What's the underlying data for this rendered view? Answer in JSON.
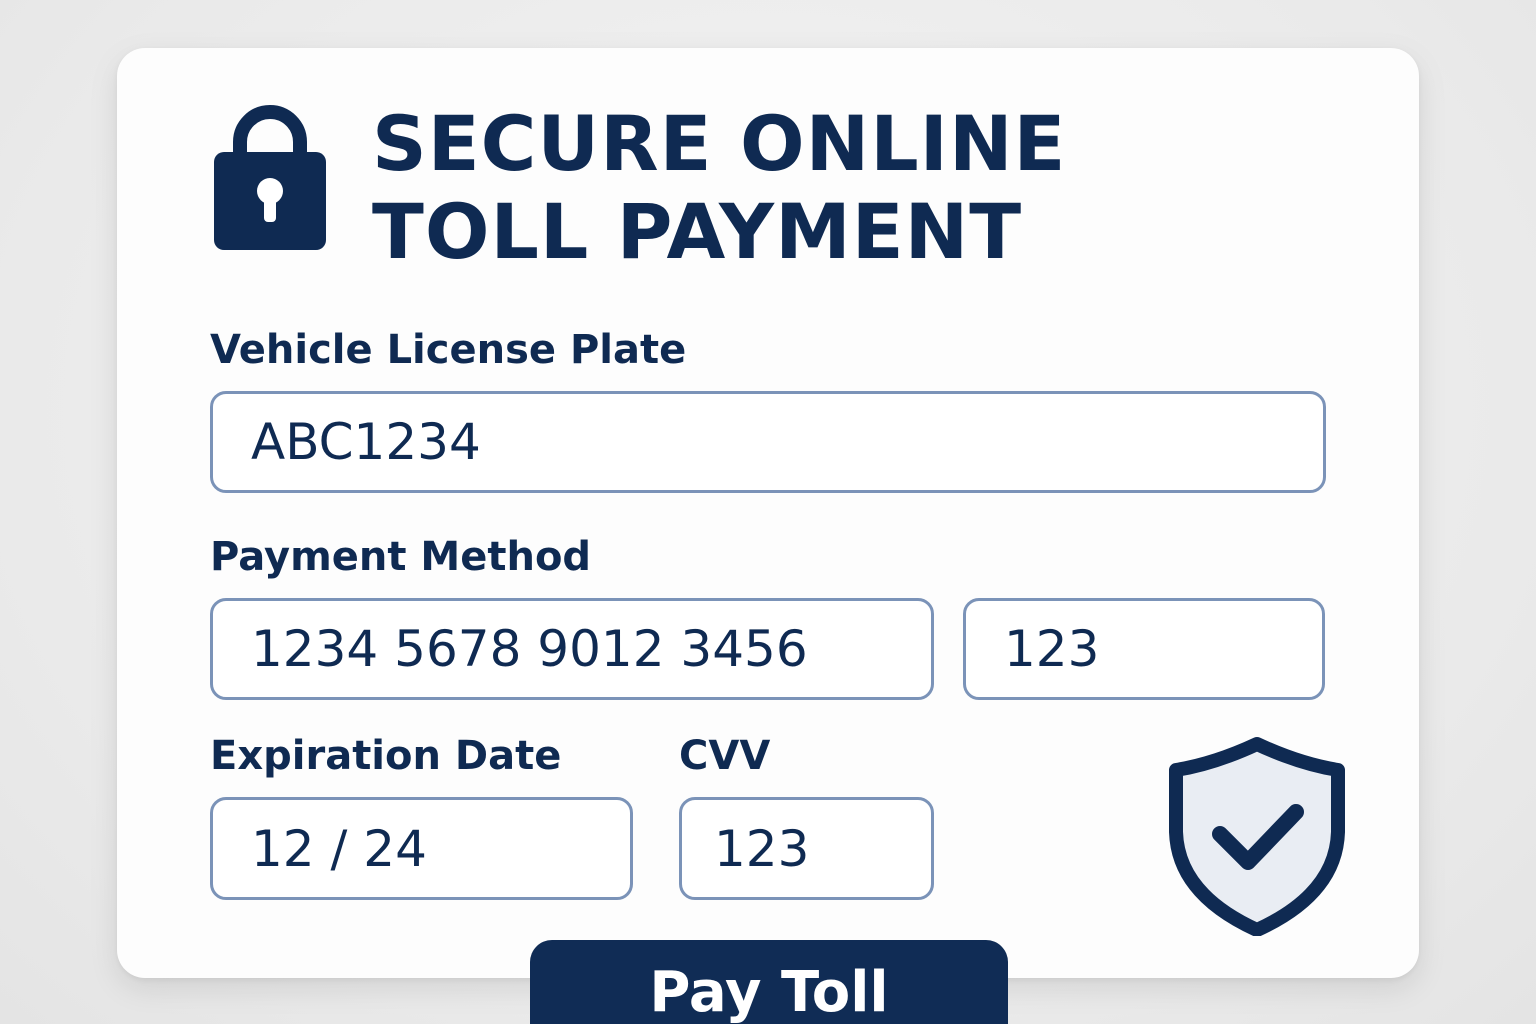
{
  "header": {
    "title_line1": "SECURE ONLINE",
    "title_line2": "TOLL PAYMENT",
    "icon": "lock-icon"
  },
  "form": {
    "license_plate": {
      "label": "Vehicle License Plate",
      "value": "ABC1234"
    },
    "payment_method": {
      "label": "Payment Method",
      "card_number": "1234 5678 9012 3456",
      "extra_code": "123"
    },
    "expiration": {
      "label": "Expiration Date",
      "value": "12 / 24"
    },
    "cvv": {
      "label": "CVV",
      "value": "123"
    }
  },
  "badge": {
    "icon": "shield-check-icon"
  },
  "actions": {
    "pay_label": "Pay Toll"
  },
  "colors": {
    "primary": "#0f2a52",
    "field_border": "#7b93b8",
    "shield_fill": "#e9edf3"
  }
}
